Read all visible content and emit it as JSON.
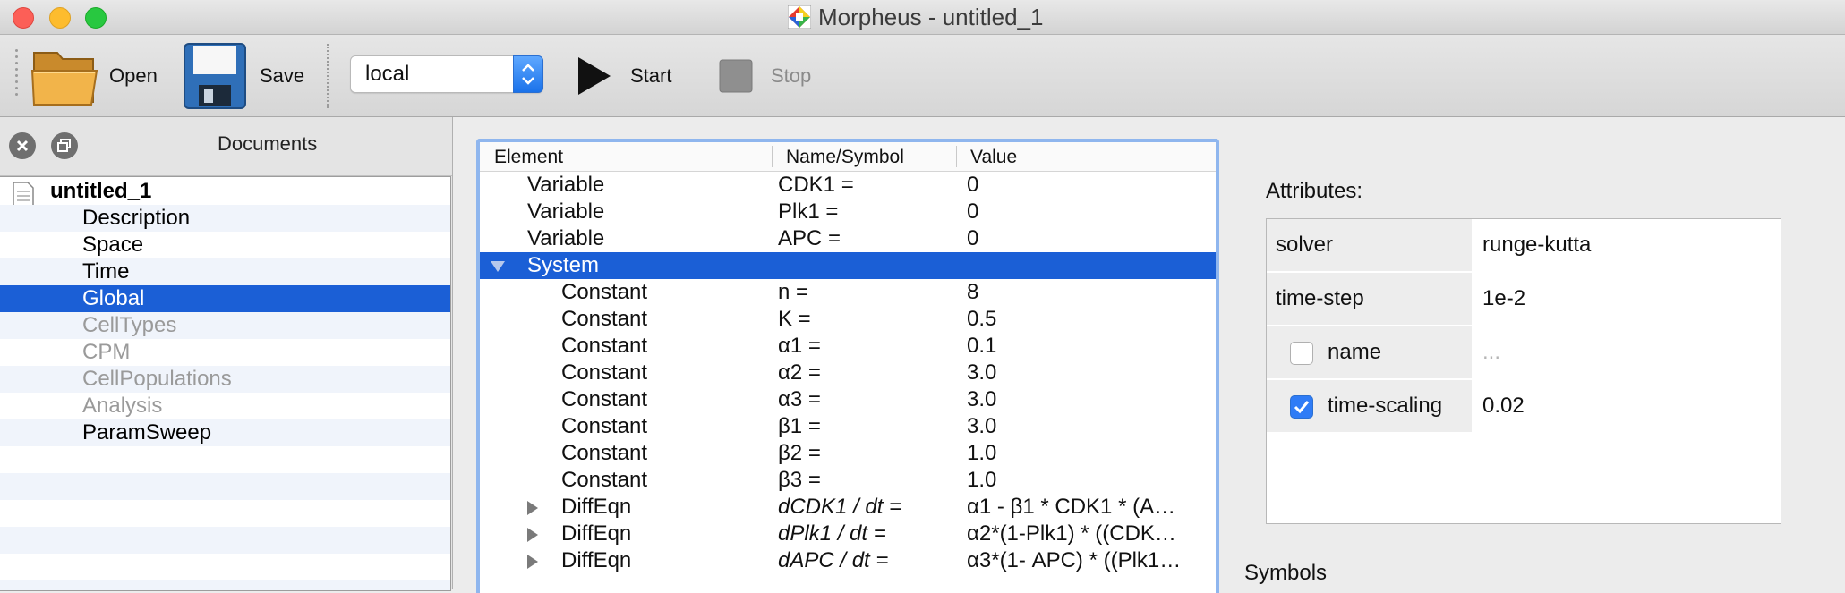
{
  "window": {
    "title": "Morpheus - untitled_1"
  },
  "toolbar": {
    "open_label": "Open",
    "save_label": "Save",
    "host_value": "local",
    "start_label": "Start",
    "stop_label": "Stop"
  },
  "documents_panel": {
    "title": "Documents",
    "tree": [
      {
        "label": "untitled_1",
        "state": "root"
      },
      {
        "label": "Description",
        "state": "normal"
      },
      {
        "label": "Space",
        "state": "normal"
      },
      {
        "label": "Time",
        "state": "normal"
      },
      {
        "label": "Global",
        "state": "selected"
      },
      {
        "label": "CellTypes",
        "state": "disabled"
      },
      {
        "label": "CPM",
        "state": "disabled"
      },
      {
        "label": "CellPopulations",
        "state": "disabled"
      },
      {
        "label": "Analysis",
        "state": "disabled"
      },
      {
        "label": "ParamSweep",
        "state": "normal"
      }
    ]
  },
  "element_table": {
    "columns": [
      "Element",
      "Name/Symbol",
      "Value"
    ],
    "rows": [
      {
        "element": "Variable",
        "name": "CDK1 =",
        "value": "0"
      },
      {
        "element": "Variable",
        "name": "Plk1 =",
        "value": "0"
      },
      {
        "element": "Variable",
        "name": "APC =",
        "value": "0"
      },
      {
        "element": "System",
        "name": "",
        "value": "",
        "expanded": true,
        "selected": true
      },
      {
        "element": "Constant",
        "name": "n =",
        "value": "8"
      },
      {
        "element": "Constant",
        "name": "K =",
        "value": "0.5"
      },
      {
        "element": "Constant",
        "name": "α1 =",
        "value": "0.1"
      },
      {
        "element": "Constant",
        "name": "α2 =",
        "value": "3.0"
      },
      {
        "element": "Constant",
        "name": "α3 =",
        "value": "3.0"
      },
      {
        "element": "Constant",
        "name": "β1 =",
        "value": "3.0"
      },
      {
        "element": "Constant",
        "name": "β2 =",
        "value": "1.0"
      },
      {
        "element": "Constant",
        "name": "β3 =",
        "value": "1.0"
      },
      {
        "element": "DiffEqn",
        "name": "dCDK1 / dt =",
        "value": "α1 - β1 * CDK1 * (A…",
        "collapsed": true
      },
      {
        "element": "DiffEqn",
        "name": "dPlk1 / dt =",
        "value": "α2*(1-Plk1) * ((CDK…",
        "collapsed": true
      },
      {
        "element": "DiffEqn",
        "name": "dAPC / dt =",
        "value": "α3*(1- APC) * ((Plk1…",
        "collapsed": true
      }
    ]
  },
  "attributes": {
    "title": "Attributes:",
    "rows": [
      {
        "key": "solver",
        "value": "runge-kutta"
      },
      {
        "key": "time-step",
        "value": "1e-2"
      },
      {
        "key": "name",
        "value": "...",
        "checkbox": false
      },
      {
        "key": "time-scaling",
        "value": "0.02",
        "checkbox": true
      }
    ]
  },
  "symbols_title": "Symbols",
  "colors": {
    "selection": "#1b5fd6",
    "accent": "#2f7cf6"
  }
}
